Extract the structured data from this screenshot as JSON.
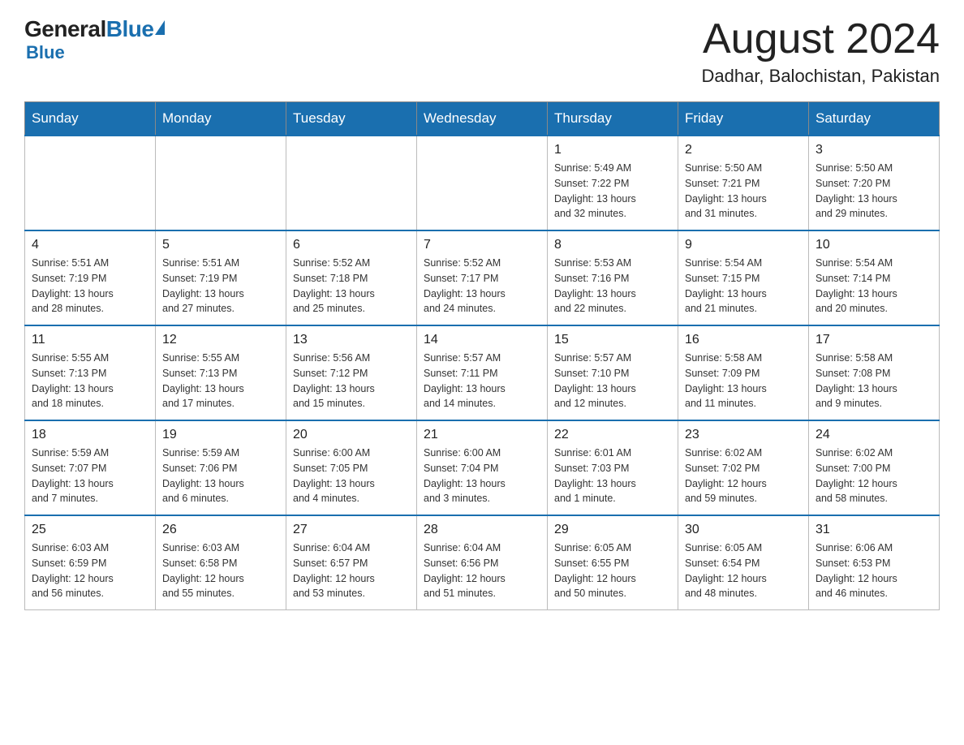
{
  "logo": {
    "general": "General",
    "blue": "Blue",
    "sub": "Blue"
  },
  "header": {
    "title": "August 2024",
    "subtitle": "Dadhar, Balochistan, Pakistan"
  },
  "days_of_week": [
    "Sunday",
    "Monday",
    "Tuesday",
    "Wednesday",
    "Thursday",
    "Friday",
    "Saturday"
  ],
  "weeks": [
    [
      {
        "day": "",
        "info": ""
      },
      {
        "day": "",
        "info": ""
      },
      {
        "day": "",
        "info": ""
      },
      {
        "day": "",
        "info": ""
      },
      {
        "day": "1",
        "info": "Sunrise: 5:49 AM\nSunset: 7:22 PM\nDaylight: 13 hours\nand 32 minutes."
      },
      {
        "day": "2",
        "info": "Sunrise: 5:50 AM\nSunset: 7:21 PM\nDaylight: 13 hours\nand 31 minutes."
      },
      {
        "day": "3",
        "info": "Sunrise: 5:50 AM\nSunset: 7:20 PM\nDaylight: 13 hours\nand 29 minutes."
      }
    ],
    [
      {
        "day": "4",
        "info": "Sunrise: 5:51 AM\nSunset: 7:19 PM\nDaylight: 13 hours\nand 28 minutes."
      },
      {
        "day": "5",
        "info": "Sunrise: 5:51 AM\nSunset: 7:19 PM\nDaylight: 13 hours\nand 27 minutes."
      },
      {
        "day": "6",
        "info": "Sunrise: 5:52 AM\nSunset: 7:18 PM\nDaylight: 13 hours\nand 25 minutes."
      },
      {
        "day": "7",
        "info": "Sunrise: 5:52 AM\nSunset: 7:17 PM\nDaylight: 13 hours\nand 24 minutes."
      },
      {
        "day": "8",
        "info": "Sunrise: 5:53 AM\nSunset: 7:16 PM\nDaylight: 13 hours\nand 22 minutes."
      },
      {
        "day": "9",
        "info": "Sunrise: 5:54 AM\nSunset: 7:15 PM\nDaylight: 13 hours\nand 21 minutes."
      },
      {
        "day": "10",
        "info": "Sunrise: 5:54 AM\nSunset: 7:14 PM\nDaylight: 13 hours\nand 20 minutes."
      }
    ],
    [
      {
        "day": "11",
        "info": "Sunrise: 5:55 AM\nSunset: 7:13 PM\nDaylight: 13 hours\nand 18 minutes."
      },
      {
        "day": "12",
        "info": "Sunrise: 5:55 AM\nSunset: 7:13 PM\nDaylight: 13 hours\nand 17 minutes."
      },
      {
        "day": "13",
        "info": "Sunrise: 5:56 AM\nSunset: 7:12 PM\nDaylight: 13 hours\nand 15 minutes."
      },
      {
        "day": "14",
        "info": "Sunrise: 5:57 AM\nSunset: 7:11 PM\nDaylight: 13 hours\nand 14 minutes."
      },
      {
        "day": "15",
        "info": "Sunrise: 5:57 AM\nSunset: 7:10 PM\nDaylight: 13 hours\nand 12 minutes."
      },
      {
        "day": "16",
        "info": "Sunrise: 5:58 AM\nSunset: 7:09 PM\nDaylight: 13 hours\nand 11 minutes."
      },
      {
        "day": "17",
        "info": "Sunrise: 5:58 AM\nSunset: 7:08 PM\nDaylight: 13 hours\nand 9 minutes."
      }
    ],
    [
      {
        "day": "18",
        "info": "Sunrise: 5:59 AM\nSunset: 7:07 PM\nDaylight: 13 hours\nand 7 minutes."
      },
      {
        "day": "19",
        "info": "Sunrise: 5:59 AM\nSunset: 7:06 PM\nDaylight: 13 hours\nand 6 minutes."
      },
      {
        "day": "20",
        "info": "Sunrise: 6:00 AM\nSunset: 7:05 PM\nDaylight: 13 hours\nand 4 minutes."
      },
      {
        "day": "21",
        "info": "Sunrise: 6:00 AM\nSunset: 7:04 PM\nDaylight: 13 hours\nand 3 minutes."
      },
      {
        "day": "22",
        "info": "Sunrise: 6:01 AM\nSunset: 7:03 PM\nDaylight: 13 hours\nand 1 minute."
      },
      {
        "day": "23",
        "info": "Sunrise: 6:02 AM\nSunset: 7:02 PM\nDaylight: 12 hours\nand 59 minutes."
      },
      {
        "day": "24",
        "info": "Sunrise: 6:02 AM\nSunset: 7:00 PM\nDaylight: 12 hours\nand 58 minutes."
      }
    ],
    [
      {
        "day": "25",
        "info": "Sunrise: 6:03 AM\nSunset: 6:59 PM\nDaylight: 12 hours\nand 56 minutes."
      },
      {
        "day": "26",
        "info": "Sunrise: 6:03 AM\nSunset: 6:58 PM\nDaylight: 12 hours\nand 55 minutes."
      },
      {
        "day": "27",
        "info": "Sunrise: 6:04 AM\nSunset: 6:57 PM\nDaylight: 12 hours\nand 53 minutes."
      },
      {
        "day": "28",
        "info": "Sunrise: 6:04 AM\nSunset: 6:56 PM\nDaylight: 12 hours\nand 51 minutes."
      },
      {
        "day": "29",
        "info": "Sunrise: 6:05 AM\nSunset: 6:55 PM\nDaylight: 12 hours\nand 50 minutes."
      },
      {
        "day": "30",
        "info": "Sunrise: 6:05 AM\nSunset: 6:54 PM\nDaylight: 12 hours\nand 48 minutes."
      },
      {
        "day": "31",
        "info": "Sunrise: 6:06 AM\nSunset: 6:53 PM\nDaylight: 12 hours\nand 46 minutes."
      }
    ]
  ]
}
